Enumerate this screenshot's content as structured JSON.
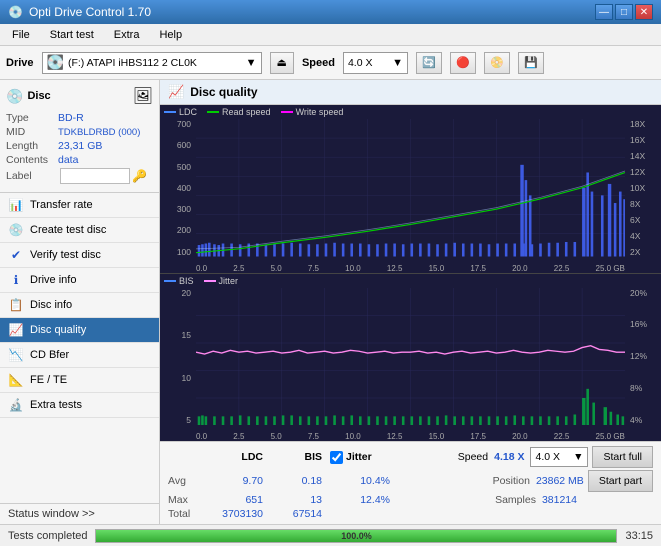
{
  "app": {
    "title": "Opti Drive Control 1.70",
    "icon": "💿"
  },
  "title_controls": {
    "minimize": "—",
    "maximize": "□",
    "close": "✕"
  },
  "menu": {
    "items": [
      "File",
      "Start test",
      "Extra",
      "Help"
    ]
  },
  "toolbar": {
    "drive_label": "Drive",
    "drive_value": "(F:)  ATAPI iHBS112  2 CL0K",
    "speed_label": "Speed",
    "speed_value": "4.0 X"
  },
  "disc": {
    "header": "Disc",
    "type_label": "Type",
    "type_value": "BD-R",
    "mid_label": "MID",
    "mid_value": "TDKBLDRBD (000)",
    "length_label": "Length",
    "length_value": "23,31 GB",
    "contents_label": "Contents",
    "contents_value": "data",
    "label_label": "Label",
    "label_value": ""
  },
  "nav_items": [
    {
      "id": "transfer-rate",
      "label": "Transfer rate",
      "icon": "📊"
    },
    {
      "id": "create-test-disc",
      "label": "Create test disc",
      "icon": "💿"
    },
    {
      "id": "verify-test-disc",
      "label": "Verify test disc",
      "icon": "✔"
    },
    {
      "id": "drive-info",
      "label": "Drive info",
      "icon": "ℹ"
    },
    {
      "id": "disc-info",
      "label": "Disc info",
      "icon": "📋"
    },
    {
      "id": "disc-quality",
      "label": "Disc quality",
      "icon": "📈",
      "active": true
    },
    {
      "id": "cd-bfer",
      "label": "CD Bfer",
      "icon": "📉"
    },
    {
      "id": "fe-te",
      "label": "FE / TE",
      "icon": "📐"
    },
    {
      "id": "extra-tests",
      "label": "Extra tests",
      "icon": "🔬"
    }
  ],
  "status_window": "Status window >>",
  "disc_quality": {
    "header": "Disc quality",
    "legend_upper": {
      "ldc": "LDC",
      "read": "Read speed",
      "write": "Write speed"
    },
    "legend_lower": {
      "bis": "BIS",
      "jitter": "Jitter"
    },
    "upper_y_labels_left": [
      "700",
      "600",
      "500",
      "400",
      "300",
      "200",
      "100"
    ],
    "upper_y_labels_right": [
      "18X",
      "16X",
      "14X",
      "12X",
      "10X",
      "8X",
      "6X",
      "4X",
      "2X"
    ],
    "lower_y_labels_left": [
      "20",
      "15",
      "10",
      "5"
    ],
    "lower_y_labels_right": [
      "20%",
      "16%",
      "12%",
      "8%",
      "4%"
    ],
    "x_labels": [
      "0.0",
      "2.5",
      "5.0",
      "7.5",
      "10.0",
      "12.5",
      "15.0",
      "17.5",
      "20.0",
      "22.5",
      "25.0"
    ],
    "x_unit": "GB"
  },
  "stats": {
    "col_ldc": "LDC",
    "col_bis": "BIS",
    "jitter_label": "Jitter",
    "speed_label": "Speed",
    "speed_value": "4.18 X",
    "speed_select": "4.0 X",
    "avg_label": "Avg",
    "avg_ldc": "9.70",
    "avg_bis": "0.18",
    "avg_jitter": "10.4%",
    "max_label": "Max",
    "max_ldc": "651",
    "max_bis": "13",
    "max_jitter": "12.4%",
    "total_label": "Total",
    "total_ldc": "3703130",
    "total_bis": "67514",
    "position_label": "Position",
    "position_value": "23862 MB",
    "samples_label": "Samples",
    "samples_value": "381214",
    "start_full_label": "Start full",
    "start_part_label": "Start part"
  },
  "bottom_status": {
    "text": "Tests completed",
    "progress": "100.0%",
    "progress_pct": 100,
    "time": "33:15"
  }
}
